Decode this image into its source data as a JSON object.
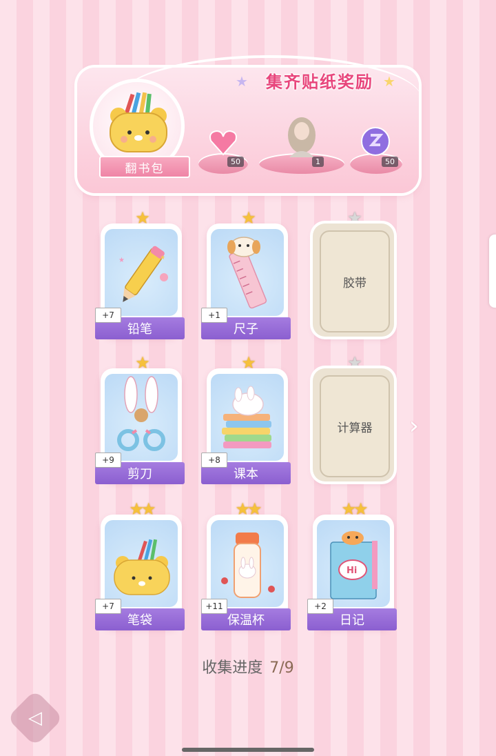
{
  "banner": {
    "title": "集齐贴纸奖励",
    "bag_label": "翻书包",
    "rewards": [
      {
        "name": "heart-gem",
        "count": "50"
      },
      {
        "name": "character-portrait",
        "count": "1"
      },
      {
        "name": "purple-orb",
        "count": "50"
      }
    ]
  },
  "cards": [
    {
      "name": "铅笔",
      "plus": "+7",
      "stars": 1,
      "collected": true,
      "icon": "pencil-icon"
    },
    {
      "name": "尺子",
      "plus": "+1",
      "stars": 1,
      "collected": true,
      "icon": "ruler-icon"
    },
    {
      "name": "胶带",
      "stars": 1,
      "collected": false
    },
    {
      "name": "剪刀",
      "plus": "+9",
      "stars": 1,
      "collected": true,
      "icon": "scissors-icon"
    },
    {
      "name": "课本",
      "plus": "+8",
      "stars": 1,
      "collected": true,
      "icon": "textbook-icon"
    },
    {
      "name": "计算器",
      "stars": 1,
      "collected": false
    },
    {
      "name": "笔袋",
      "plus": "+7",
      "stars": 2,
      "collected": true,
      "icon": "pencil-case-icon"
    },
    {
      "name": "保温杯",
      "plus": "+11",
      "stars": 2,
      "collected": true,
      "icon": "thermos-icon"
    },
    {
      "name": "日记",
      "plus": "+2",
      "stars": 2,
      "collected": true,
      "icon": "diary-icon"
    }
  ],
  "progress": {
    "label": "收集进度",
    "value": "7/9"
  },
  "colors": {
    "accent": "#e8467c",
    "name_bar": "#8b5fd0",
    "star_gold": "#f6c13b",
    "locked_card": "#ece3d3"
  }
}
